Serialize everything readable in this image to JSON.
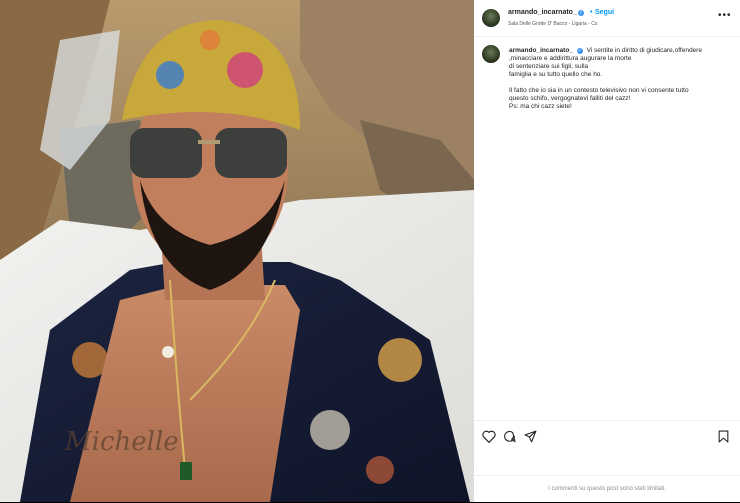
{
  "post": {
    "username": "armando_incarnato_",
    "follow_label": "Segui",
    "location": "Sala Delle Grotte D' Bacco - Ligaria - Cs",
    "caption_username": "armando_incarnato_",
    "caption_lines": [
      "Vi sentite in diritto di giudicare,offendere",
      ",minacciare e addirittura augurare la morte",
      "di sentenziare sui figli, sulla",
      "famiglia e su tutto quello che ho.",
      "",
      "Il fatto che io sia in un contesto televisivo non vi consente tutto",
      "questo schifo, vergognatevi falliti del cazz!",
      "Ps: ma chi cazz siete!"
    ],
    "comments_disabled_text": "I commenti su questo post sono stati limitati."
  },
  "icons": {
    "verified": "verified-badge-icon",
    "more": "more-options-icon",
    "like": "heart-icon",
    "comment": "comment-icon",
    "share": "share-icon",
    "save": "bookmark-icon"
  },
  "colors": {
    "link_blue": "#0095f6",
    "verified_blue": "#3897f0",
    "text": "#262626",
    "muted": "#8e8e8e"
  }
}
